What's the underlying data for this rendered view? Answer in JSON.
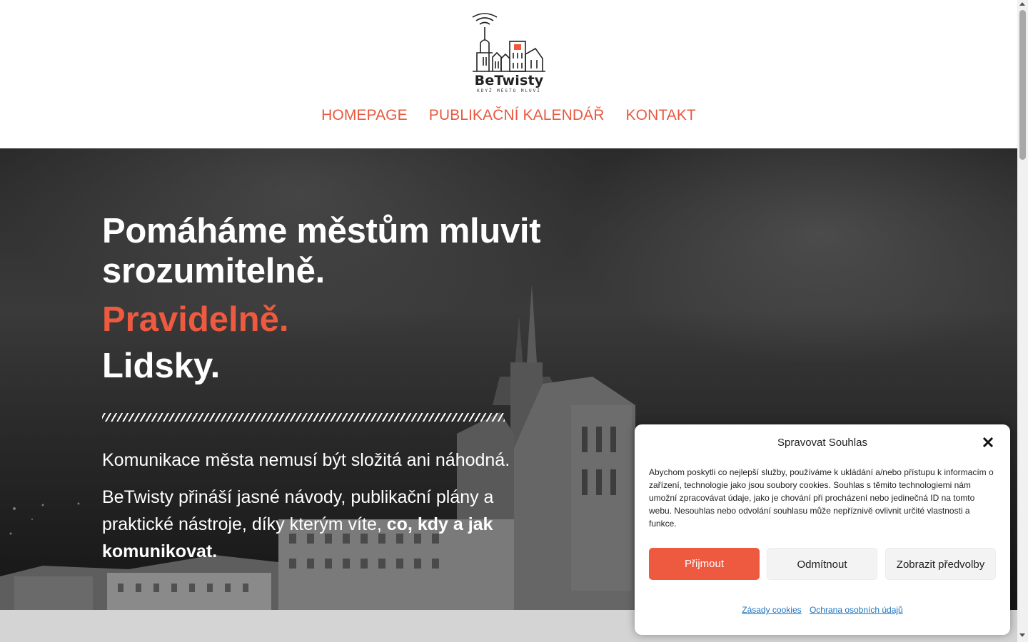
{
  "brand": {
    "name": "BeTwisty",
    "tagline": "KDYŽ MĚSTO MLUVÍ",
    "accent": "#ee5a40"
  },
  "nav": {
    "items": [
      {
        "label": "HOMEPAGE"
      },
      {
        "label": "PUBLIKAČNÍ KALENDÁŘ"
      },
      {
        "label": "KONTAKT"
      }
    ]
  },
  "hero": {
    "title": "Pomáháme městům mluvit srozumitelně.",
    "accent_line": "Pravidelně.",
    "second_line": "Lidsky.",
    "paragraph1": "Komunikace města nemusí být složitá ani náhodná.",
    "paragraph2_text": "BeTwisty přináší jasné návody, publikační plány a praktické nástroje, díky kterým víte, ",
    "paragraph2_bold": "co, kdy a jak komunikovat."
  },
  "consent": {
    "title": "Spravovat Souhlas",
    "text": "Abychom poskytli co nejlepší služby, používáme k ukládání a/nebo přístupu k informacím o zařízení, technologie jako jsou soubory cookies. Souhlas s těmito technologiemi nám umožní zpracovávat údaje, jako je chování při procházení nebo jedinečná ID na tomto webu. Nesouhlas nebo odvolání souhlasu může nepříznivě ovlivnit určité vlastnosti a funkce.",
    "accept_label": "Přijmout",
    "deny_label": "Odmítnout",
    "preferences_label": "Zobrazit předvolby",
    "cookie_policy_link": "Zásady cookies",
    "privacy_link": "Ochrana osobních údajů",
    "close_icon": "close-icon"
  }
}
